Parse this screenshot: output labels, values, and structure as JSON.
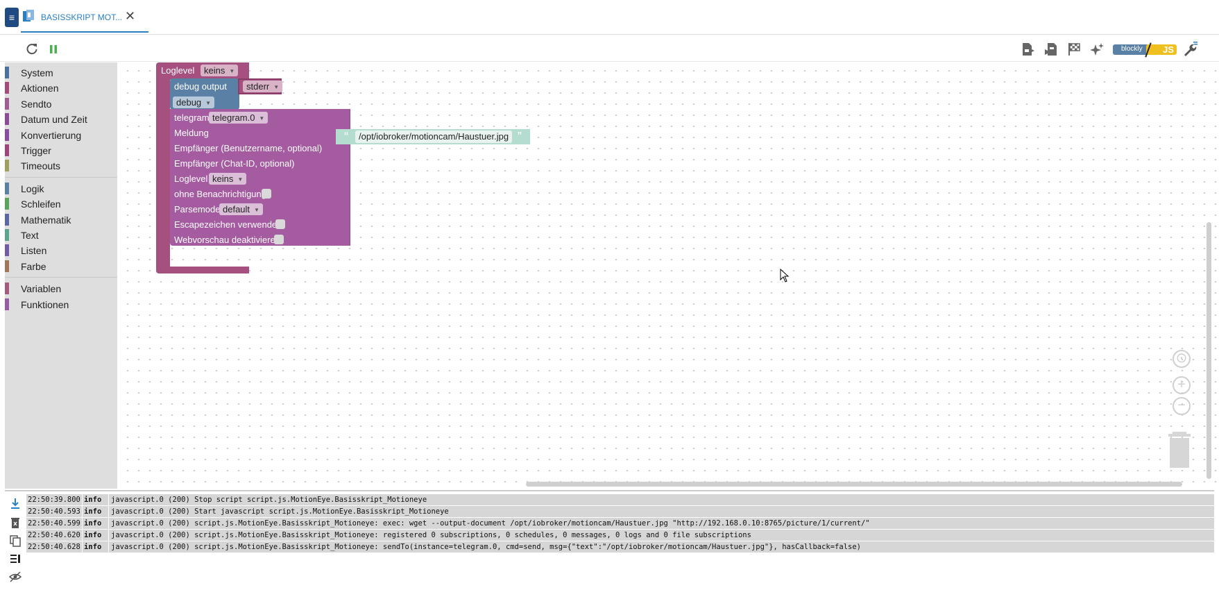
{
  "tab": {
    "label": "BASISSKRIPT MOT...",
    "close_glyph": "✕"
  },
  "toolbar": {
    "icons": [
      "reload-icon",
      "pause-icon",
      "export-icon",
      "import-icon",
      "flag-icon",
      "sparkle-icon",
      "blockly-js-toggle",
      "wrench-icon"
    ],
    "blockly_label": "blockly",
    "js_label": "JS"
  },
  "sidebar": {
    "groups": [
      [
        {
          "label": "System",
          "color": "#4a6fa0"
        },
        {
          "label": "Aktionen",
          "color": "#a64a7a"
        },
        {
          "label": "Sendto",
          "color": "#a25c93"
        },
        {
          "label": "Datum und Zeit",
          "color": "#8f4a9a"
        },
        {
          "label": "Konvertierung",
          "color": "#8a4ba0"
        },
        {
          "label": "Trigger",
          "color": "#a0447a"
        },
        {
          "label": "Timeouts",
          "color": "#a0a05c"
        }
      ],
      [
        {
          "label": "Logik",
          "color": "#5b80a5"
        },
        {
          "label": "Schleifen",
          "color": "#5ba55b"
        },
        {
          "label": "Mathematik",
          "color": "#5b67a5"
        },
        {
          "label": "Text",
          "color": "#5ba58c"
        },
        {
          "label": "Listen",
          "color": "#745ba5"
        },
        {
          "label": "Farbe",
          "color": "#a5745b"
        }
      ],
      [
        {
          "label": "Variablen",
          "color": "#a55b80"
        },
        {
          "label": "Funktionen",
          "color": "#995ba5"
        }
      ]
    ]
  },
  "blocks": {
    "outer": {
      "label": "Loglevel",
      "dropdown": "keins",
      "color": "#a5507f"
    },
    "debug": {
      "label": "debug output",
      "stream": "stderr",
      "level": "debug",
      "color": "#5b80a5"
    },
    "telegram": {
      "label": "telegram",
      "instance": "telegram.0",
      "color": "#a55ba0",
      "rows": {
        "meldung": "Meldung",
        "empf_user": "Empfänger (Benutzername, optional)",
        "empf_chat": "Empfänger (Chat-ID, optional)",
        "loglevel": "Loglevel",
        "loglevel_value": "keins",
        "ohne": "ohne Benachrichtigung",
        "parsemode": "Parsemode",
        "parsemode_value": "default",
        "escape": "Escapezeichen verwenden",
        "webvorschau": "Webvorschau deaktivieren"
      }
    },
    "text": {
      "value": "/opt/iobroker/motioncam/Haustuer.jpg",
      "color": "#5ba58c",
      "open_quote": "“",
      "close_quote": "”"
    }
  },
  "log": {
    "tools": [
      "scroll-bottom-icon",
      "clear-log-icon",
      "copy-log-icon",
      "toggle-details-icon",
      "hide-log-icon"
    ],
    "rows": [
      {
        "time": "22:50:39.800",
        "level": "info",
        "msg": "javascript.0 (200) Stop script script.js.MotionEye.Basisskript_Motioneye"
      },
      {
        "time": "22:50:40.593",
        "level": "info",
        "msg": "javascript.0 (200) Start javascript script.js.MotionEye.Basisskript_Motioneye"
      },
      {
        "time": "22:50:40.599",
        "level": "info",
        "msg": "javascript.0 (200) script.js.MotionEye.Basisskript_Motioneye: exec: wget --output-document /opt/iobroker/motioncam/Haustuer.jpg \"http://192.168.0.10:8765/picture/1/current/\""
      },
      {
        "time": "22:50:40.620",
        "level": "info",
        "msg": "javascript.0 (200) script.js.MotionEye.Basisskript_Motioneye: registered 0 subscriptions, 0 schedules, 0 messages, 0 logs and 0 file subscriptions"
      },
      {
        "time": "22:50:40.628",
        "level": "info",
        "msg": "javascript.0 (200) script.js.MotionEye.Basisskript_Motioneye: sendTo(instance=telegram.0, cmd=send, msg={\"text\":\"/opt/iobroker/motioncam/Haustuer.jpg\"}, hasCallback=false)"
      }
    ]
  }
}
